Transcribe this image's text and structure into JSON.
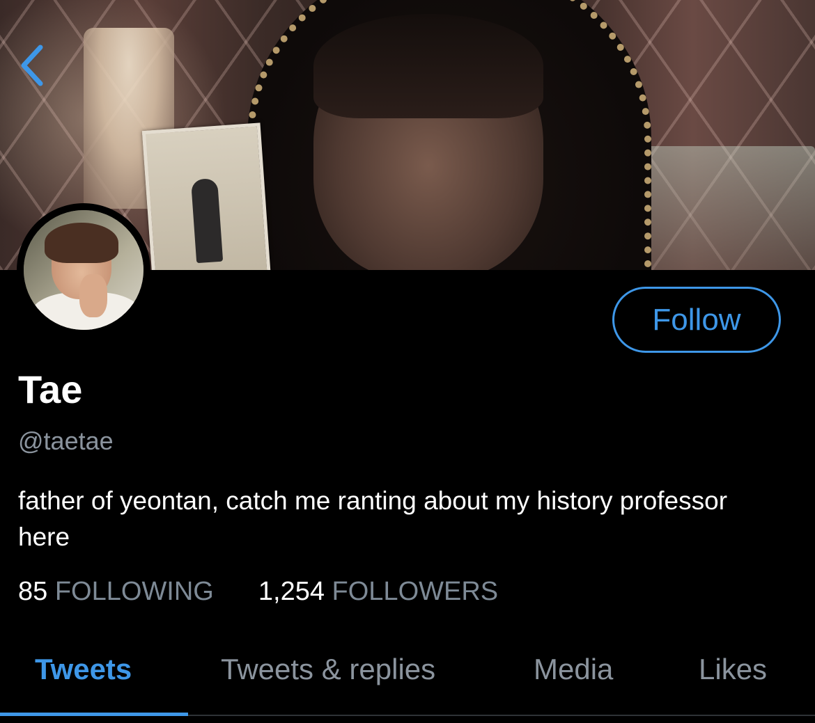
{
  "header": {
    "back_icon": "chevron-left-icon",
    "back_color": "#3e97e8"
  },
  "profile": {
    "display_name": "Tae",
    "handle": "@taetae",
    "bio": "father of yeontan, catch me ranting about my history professor here",
    "follow_label": "Follow",
    "following_count": "85",
    "following_label": "FOLLOWING",
    "followers_count": "1,254",
    "followers_label": "FOLLOWERS"
  },
  "tabs": [
    {
      "label": "Tweets",
      "active": true
    },
    {
      "label": "Tweets & replies",
      "active": false
    },
    {
      "label": "Media",
      "active": false
    },
    {
      "label": "Likes",
      "active": false
    }
  ],
  "colors": {
    "accent": "#3e97e8",
    "background": "#000000",
    "secondary_text": "#8b949e"
  }
}
